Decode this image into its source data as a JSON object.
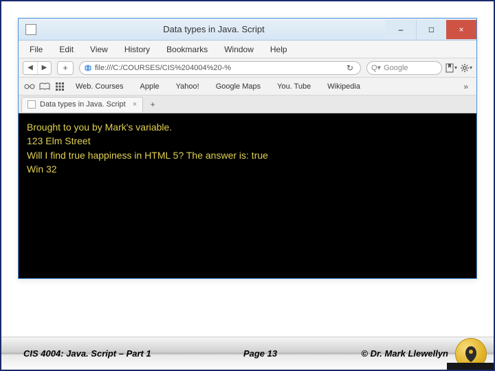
{
  "window": {
    "title": "Data types in Java. Script",
    "controls": {
      "min": "–",
      "max": "□",
      "close": "×"
    }
  },
  "menubar": [
    "File",
    "Edit",
    "View",
    "History",
    "Bookmarks",
    "Window",
    "Help"
  ],
  "toolbar": {
    "back": "◀",
    "fwd": "▶",
    "plus": "+",
    "url": "file:///C:/COURSES/CIS%204004%20-%",
    "reload": "↻",
    "search_placeholder": "Google",
    "search_icon": "Q▾"
  },
  "bookmarks": {
    "icons": [
      "glasses",
      "book",
      "grid"
    ],
    "items": [
      "Web. Courses",
      "Apple",
      "Yahoo!",
      "Google Maps",
      "You. Tube",
      "Wikipedia"
    ],
    "more": "»"
  },
  "tab": {
    "label": "Data types in Java. Script",
    "close": "×",
    "plus": "+"
  },
  "page": {
    "l1": "Brought to you by Mark's variable.",
    "l2": "123 Elm Street",
    "l3": "Will I find true happiness in HTML 5? The answer is: true",
    "l4": "Win 32"
  },
  "footer": {
    "left": "CIS 4004: Java. Script – Part 1",
    "center": "Page 13",
    "right": "© Dr. Mark Llewellyn"
  }
}
